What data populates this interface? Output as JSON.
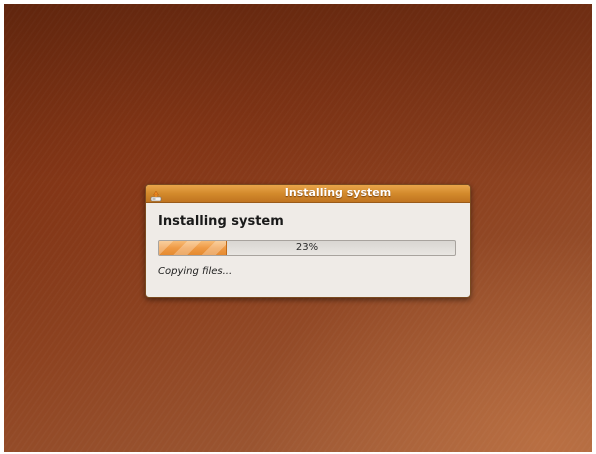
{
  "window": {
    "title": "Installing system",
    "icon": "installer-icon",
    "titlebar_color": "#d38a2c"
  },
  "dialog": {
    "heading": "Installing system",
    "progress": {
      "percent": 23,
      "label": "23%",
      "fill_color": "#ef9a44"
    },
    "status": "Copying files..."
  },
  "desktop": {
    "background_color": "#8d4220"
  }
}
